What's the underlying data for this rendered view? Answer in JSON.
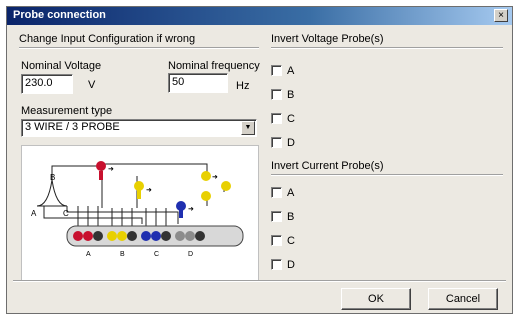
{
  "window": {
    "title": "Probe connection",
    "close_glyph": "×"
  },
  "config": {
    "section_label": "Change Input Configuration if wrong",
    "nominal_voltage_label": "Nominal Voltage",
    "nominal_voltage_value": "230.0",
    "voltage_unit": "V",
    "nominal_frequency_label": "Nominal frequency",
    "nominal_frequency_value": "50",
    "frequency_unit": "Hz",
    "measurement_type_label": "Measurement type",
    "measurement_type_value": "3 WIRE / 3 PROBE"
  },
  "diagram": {
    "phase_labels": [
      "A",
      "B",
      "C"
    ],
    "connector_labels": [
      "A",
      "B",
      "C",
      "D"
    ],
    "colors": {
      "red": "#c8102e",
      "yellow": "#e8d000",
      "blue": "#1f2fb0",
      "gray": "#8c8c8c",
      "dark": "#222222"
    }
  },
  "invert_voltage": {
    "label": "Invert Voltage Probe(s)",
    "options": [
      "A",
      "B",
      "C",
      "D"
    ]
  },
  "invert_current": {
    "label": "Invert Current Probe(s)",
    "options": [
      "A",
      "B",
      "C",
      "D"
    ]
  },
  "buttons": {
    "ok": "OK",
    "cancel": "Cancel"
  }
}
